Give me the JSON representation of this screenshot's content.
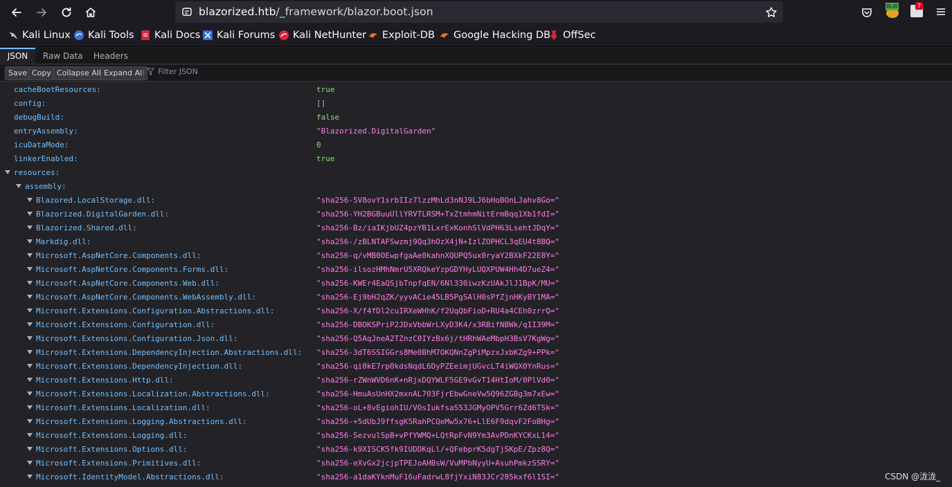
{
  "browser": {
    "url_host": "blazorized.htb",
    "url_path": "/_framework/blazor.boot.json"
  },
  "bookmarks": [
    {
      "label": "Kali Linux"
    },
    {
      "label": "Kali Tools"
    },
    {
      "label": "Kali Docs"
    },
    {
      "label": "Kali Forums"
    },
    {
      "label": "Kali NetHunter"
    },
    {
      "label": "Exploit-DB"
    },
    {
      "label": "Google Hacking DB"
    },
    {
      "label": "OffSec"
    }
  ],
  "extensions": {
    "burp_label": "BUR",
    "badge_count": "7"
  },
  "viewer": {
    "tabs": [
      "JSON",
      "Raw Data",
      "Headers"
    ],
    "toolbar": {
      "save": "Save",
      "copy": "Copy",
      "collapse": "Collapse All",
      "expand": "Expand All",
      "filter_placeholder": "Filter JSON"
    }
  },
  "json_rows": [
    {
      "key": "cacheBootResources:",
      "value": "true",
      "type": "bool"
    },
    {
      "key": "config:",
      "value": "[]",
      "type": "arr"
    },
    {
      "key": "debugBuild:",
      "value": "false",
      "type": "bool"
    },
    {
      "key": "entryAssembly:",
      "value": "\"Blazorized.DigitalGarden\"",
      "type": "str"
    },
    {
      "key": "icuDataMode:",
      "value": "0",
      "type": "num"
    },
    {
      "key": "linkerEnabled:",
      "value": "true",
      "type": "bool"
    },
    {
      "key": "resources:",
      "value": "",
      "type": "obj"
    },
    {
      "key": "assembly:",
      "value": "",
      "type": "obj"
    },
    {
      "key": "Blazored.LocalStorage.dll:",
      "value": "\"sha256-5V8ovY1srbIIz7lzzMhLd3nNJ9LJ6bHoBOnLJahv8Go=\"",
      "type": "str"
    },
    {
      "key": "Blazorized.DigitalGarden.dll:",
      "value": "\"sha256-YH2BGBuuUllYRVTLRSM+TxZtmhmNitErmBqq1Xb1fdI=\"",
      "type": "str"
    },
    {
      "key": "Blazorized.Shared.dll:",
      "value": "\"sha256-Bz/iaIKjbUZ4pzYB1LxrExKonhSlVdPH63LsehtJDqY=\"",
      "type": "str"
    },
    {
      "key": "Markdig.dll:",
      "value": "\"sha256-/zBLNTAFSwzmj9Qq3hOzX4jN+IzlZOPHCL3qEU4t8BQ=\"",
      "type": "str"
    },
    {
      "key": "Microsoft.AspNetCore.Components.dll:",
      "value": "\"sha256-q/vMB0OEwpfgaAe0kahnXQUPQ5ux0ryaY2BXkF22E8Y=\"",
      "type": "str"
    },
    {
      "key": "Microsoft.AspNetCore.Components.Forms.dll:",
      "value": "\"sha256-ilsozHMhNmrU5XRQkeYzpGDYHyLUQXPUW4Hh4D7ueZ4=\"",
      "type": "str"
    },
    {
      "key": "Microsoft.AspNetCore.Components.Web.dll:",
      "value": "\"sha256-KWEr4EaQSjbTnpfqEN/6Nl330iwzKzUAkJlJ1BpK/MU=\"",
      "type": "str"
    },
    {
      "key": "Microsoft.AspNetCore.Components.WebAssembly.dll:",
      "value": "\"sha256-Ej9bH2qZK/yyvACie45LB5PgSAlH0sPfZjnHKyBY1MA=\"",
      "type": "str"
    },
    {
      "key": "Microsoft.Extensions.Configuration.Abstractions.dll:",
      "value": "\"sha256-X/f4fDl2cuIRXeWHhK/f2UqQbFioD+RU4a4CEh0zrrQ=\"",
      "type": "str"
    },
    {
      "key": "Microsoft.Extensions.Configuration.dll:",
      "value": "\"sha256-DBOKSPriP2JDxVbbWrLXyD3K4/x3RBifNBWk/q1I39M=\"",
      "type": "str"
    },
    {
      "key": "Microsoft.Extensions.Configuration.Json.dll:",
      "value": "\"sha256-Q5AqJneA2TZnzC0IYzBx6j/tHRhWAeMbpH3BsV7KgWg=\"",
      "type": "str"
    },
    {
      "key": "Microsoft.Extensions.DependencyInjection.Abstractions.dll:",
      "value": "\"sha256-3dT6SSIGGrs8Me0BhM7OKQNnZgPiMpzxJxbKZg9+PPk=\"",
      "type": "str"
    },
    {
      "key": "Microsoft.Extensions.DependencyInjection.dll:",
      "value": "\"sha256-qi0kE7rp0kdsNqdL6DyPZEeimjUGvcLT4iWQX0YnRus=\"",
      "type": "str"
    },
    {
      "key": "Microsoft.Extensions.Http.dll:",
      "value": "\"sha256-rZWnWVD6nK+nRjxDQYWLF5GE9vGvT14HtIoM/0PlVd0=\"",
      "type": "str"
    },
    {
      "key": "Microsoft.Extensions.Localization.Abstractions.dll:",
      "value": "\"sha256-HmuAsUnHX2mxnAL703FjrEbwGneVw5Q96ZGBg3m7xEw=\"",
      "type": "str"
    },
    {
      "key": "Microsoft.Extensions.Localization.dll:",
      "value": "\"sha256-oL+8vEgiohIU/VOsIukfsaS53JGMyOPV5Grr6Zd6TSk=\"",
      "type": "str"
    },
    {
      "key": "Microsoft.Extensions.Logging.Abstractions.dll:",
      "value": "\"sha256-+5dUbJ9ffsgK5RahPCQeMw5x76+LlE6F9dqvF2FoBHg=\"",
      "type": "str"
    },
    {
      "key": "Microsoft.Extensions.Logging.dll:",
      "value": "\"sha256-SezvulSpB+vPfYWMQ+LQtRpFvN9Ym3AvPDnKYCKxL14=\"",
      "type": "str"
    },
    {
      "key": "Microsoft.Extensions.Options.dll:",
      "value": "\"sha256-k9XISCK5fk9IUDDKqLl/+QFebprK5dgTjSKpE/Zpz8Q=\"",
      "type": "str"
    },
    {
      "key": "Microsoft.Extensions.Primitives.dll:",
      "value": "\"sha256-eXvGx2jcjpTPEJoAHBsW/VuMPbNyyU+AsuhPmkzSSRY=\"",
      "type": "str"
    },
    {
      "key": "Microsoft.IdentityModel.Abstractions.dll:",
      "value": "\"sha256-a1daKYknMuF16uFadrwL8fjYxiN83JCr285kxf6l1SI=\"",
      "type": "str"
    }
  ],
  "watermark": "CSDN @泷泷_"
}
